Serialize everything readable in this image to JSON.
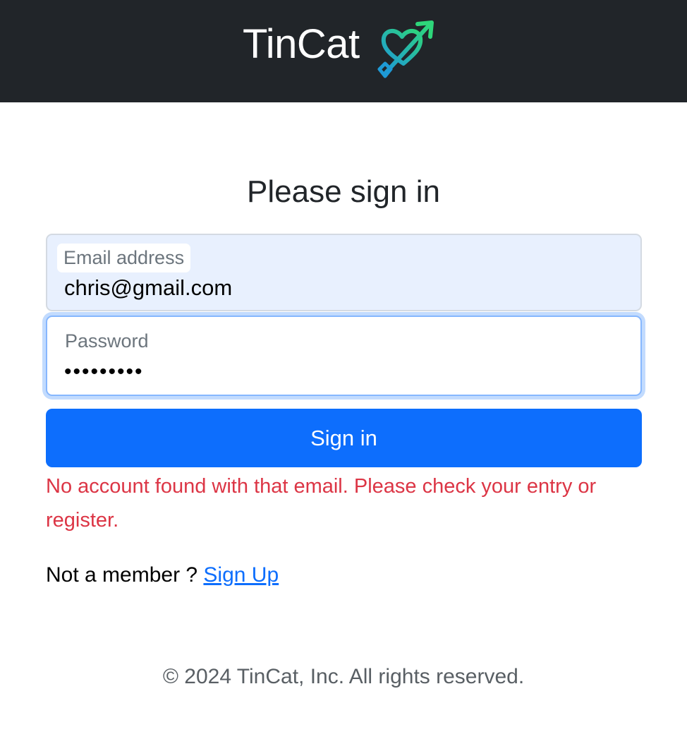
{
  "header": {
    "brand_name": "TinCat",
    "logo_icon": "heart-arrow-icon",
    "background": "#212529"
  },
  "form": {
    "title": "Please sign in",
    "email": {
      "label": "Email address",
      "value": "chris@gmail.com"
    },
    "password": {
      "label": "Password",
      "value": "•••••••••"
    },
    "submit_label": "Sign in",
    "error_message": "No account found with that email. Please check your entry or register.",
    "not_member_text": "Not a member ? ",
    "signup_link": "Sign Up"
  },
  "footer": {
    "copyright": "© 2024 TinCat, Inc. All rights reserved."
  },
  "colors": {
    "primary": "#0d6efd",
    "danger": "#dc3545",
    "autofill_bg": "#e8f0fe",
    "logo_gradient_start": "#2ed67a",
    "logo_gradient_end": "#1e9ad6"
  }
}
